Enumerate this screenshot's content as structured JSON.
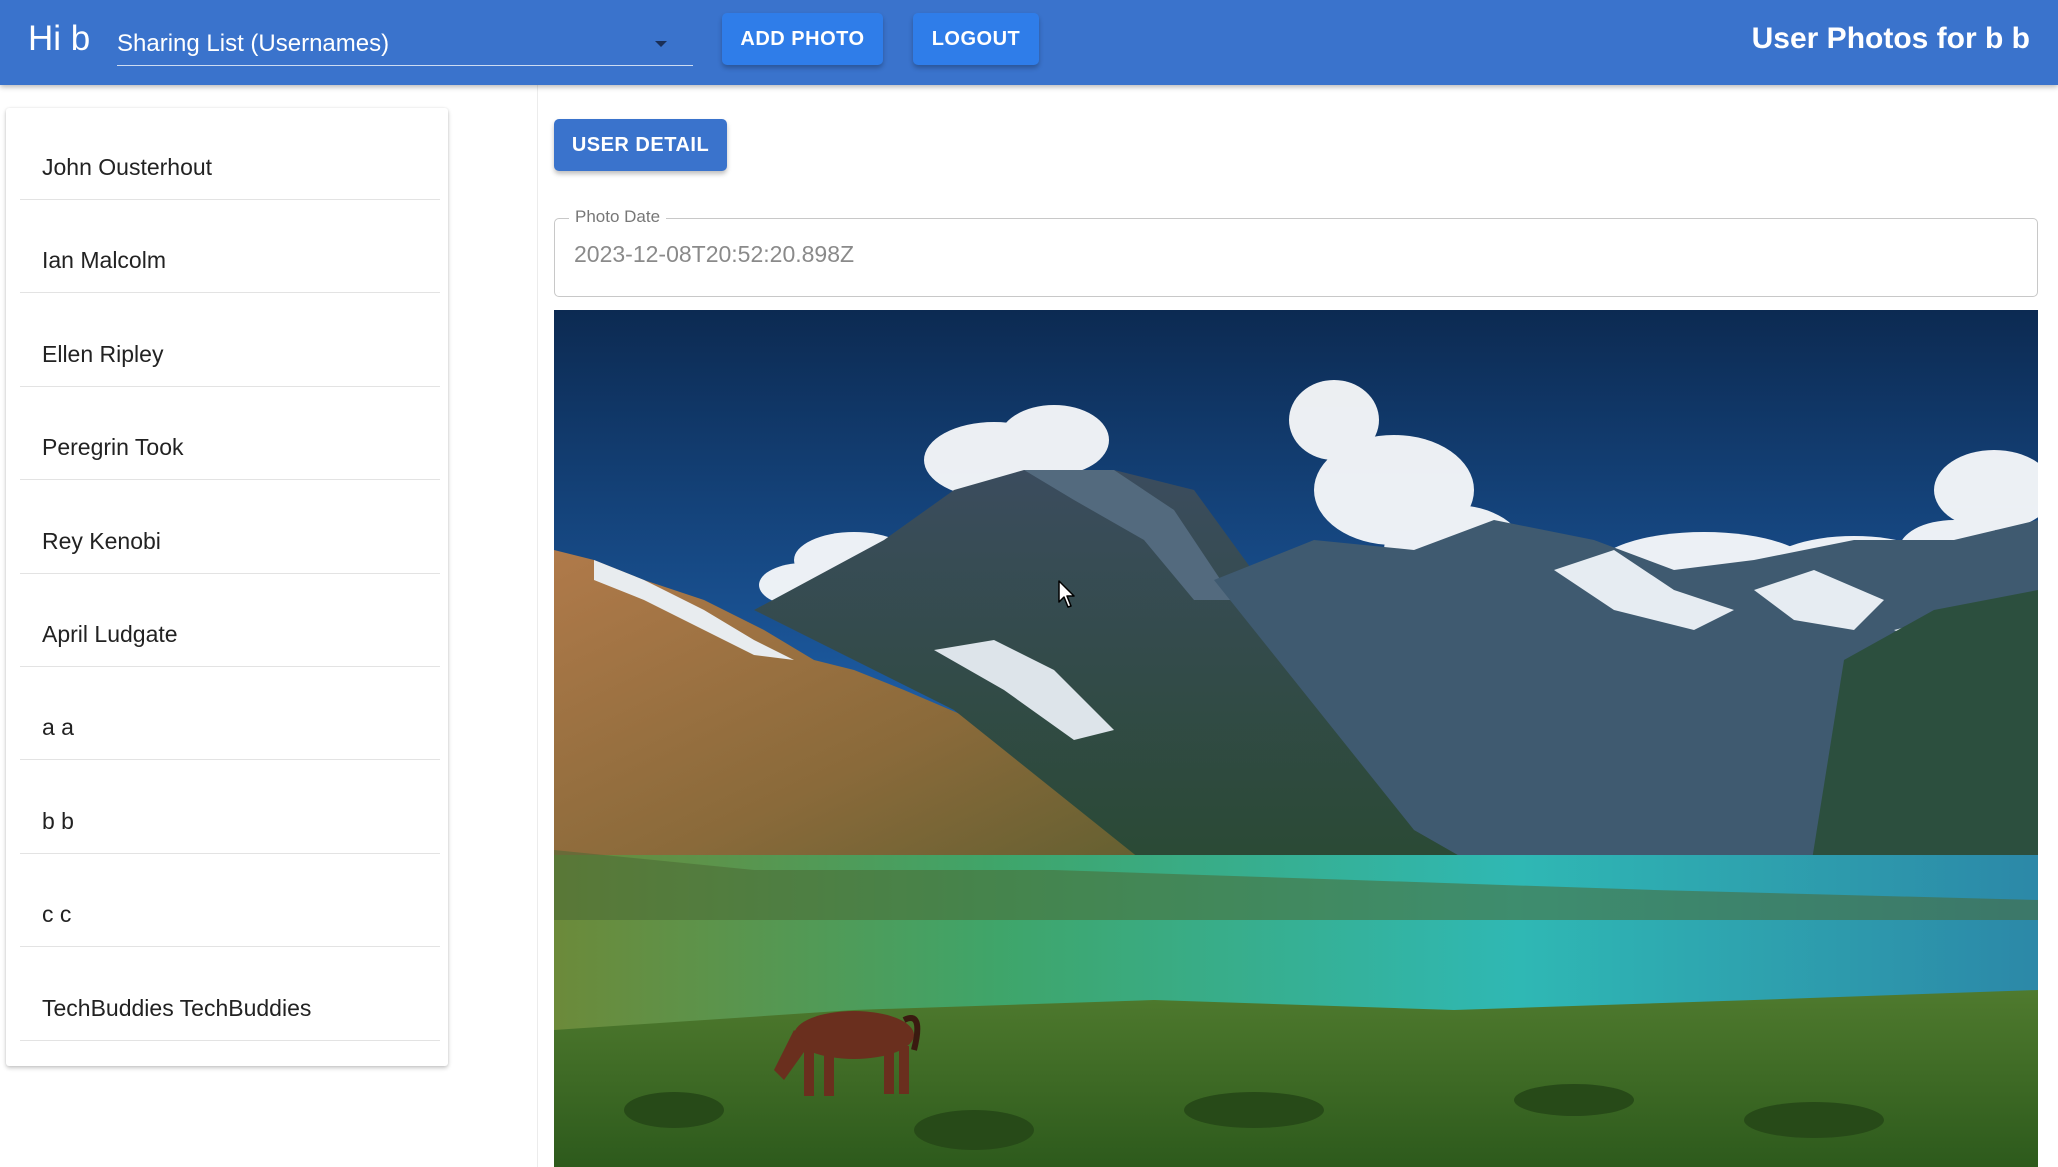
{
  "header": {
    "greeting": "Hi b",
    "sharing_list_label": "Sharing List (Usernames)",
    "add_photo_label": "ADD PHOTO",
    "logout_label": "LOGOUT",
    "title": "User Photos for b b"
  },
  "sidebar": {
    "users": [
      {
        "name": "John Ousterhout"
      },
      {
        "name": "Ian Malcolm"
      },
      {
        "name": "Ellen Ripley"
      },
      {
        "name": "Peregrin Took"
      },
      {
        "name": "Rey Kenobi"
      },
      {
        "name": "April Ludgate"
      },
      {
        "name": "a a"
      },
      {
        "name": "b b"
      },
      {
        "name": "c c"
      },
      {
        "name": "TechBuddies TechBuddies"
      }
    ]
  },
  "main": {
    "user_detail_label": "USER DETAIL",
    "photo_date_label": "Photo Date",
    "photo_date_value": "2023-12-08T20:52:20.898Z"
  },
  "colors": {
    "appbar": "#3a73cc",
    "button": "#2f7de9"
  }
}
